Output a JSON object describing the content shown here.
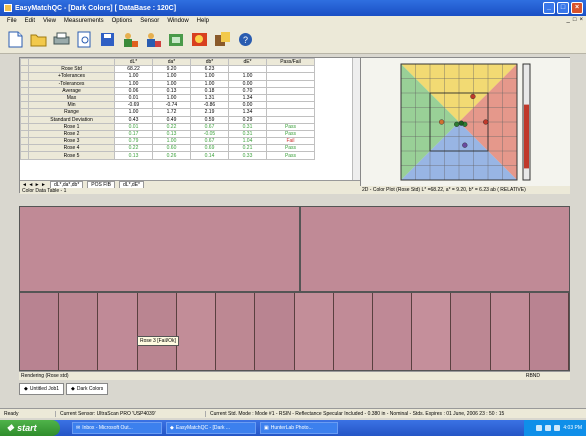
{
  "window": {
    "title": "EasyMatchQC - [Dark Colors]   [ DataBase : 120C]",
    "min": "_",
    "max": "□",
    "close": "×"
  },
  "menu": {
    "items": [
      "File",
      "Edit",
      "View",
      "Measurements",
      "Options",
      "Sensor",
      "Window",
      "Help"
    ],
    "mdi": [
      "_",
      "□",
      "×"
    ]
  },
  "toolbar": {
    "icons": [
      "new-icon",
      "open-icon",
      "print-icon",
      "preview-icon",
      "save-icon",
      "standardize-icon",
      "measure-icon",
      "read-icon",
      "database-icon",
      "export-icon",
      "help-icon"
    ]
  },
  "grid": {
    "headers": [
      "",
      "dL*",
      "da*",
      "db*",
      "dE*",
      "Pass/Fail"
    ],
    "stat_rows": [
      {
        "label": "Rose Std",
        "values": [
          "68.22",
          "9.20",
          "6.23",
          "",
          ""
        ]
      },
      {
        "label": "+Tolerances",
        "values": [
          "1.00",
          "1.00",
          "1.00",
          "1.00",
          ""
        ]
      },
      {
        "label": "-Tolerances",
        "values": [
          "1.00",
          "1.00",
          "1.00",
          "0.00",
          ""
        ]
      },
      {
        "label": "Average",
        "values": [
          "0.06",
          "0.13",
          "0.18",
          "0.70",
          ""
        ]
      },
      {
        "label": "Max",
        "values": [
          "0.01",
          "1.00",
          "1.31",
          "1.34",
          ""
        ]
      },
      {
        "label": "Min",
        "values": [
          "-0.69",
          "-0.74",
          "-0.86",
          "0.00",
          ""
        ]
      },
      {
        "label": "Range",
        "values": [
          "1.00",
          "1.72",
          "2.19",
          "1.34",
          ""
        ]
      },
      {
        "label": "Standard Deviation",
        "values": [
          "0.43",
          "0.49",
          "0.59",
          "0.29",
          ""
        ]
      }
    ],
    "sample_rows": [
      {
        "label": "Rose 1",
        "values": [
          "0.01",
          "0.22",
          "0.67",
          "0.31",
          "Pass"
        ],
        "fail": false
      },
      {
        "label": "Rose 2",
        "values": [
          "0.17",
          "0.13",
          "-0.05",
          "0.31",
          "Pass"
        ],
        "fail": false
      },
      {
        "label": "Rose 3",
        "values": [
          "0.79",
          "1.00",
          "0.67",
          "1.04",
          "Fail"
        ],
        "fail": true
      },
      {
        "label": "Rose 4",
        "values": [
          "0.22",
          "0.60",
          "0.69",
          "0.21",
          "Pass"
        ],
        "fail": false
      },
      {
        "label": "Rose 5",
        "values": [
          "0.13",
          "0.26",
          "0.14",
          "0.33",
          "Pass"
        ],
        "fail": false
      }
    ],
    "sheet_tabs": [
      "dL*,da*,db*",
      "POS FIB",
      "dL*,dE*"
    ],
    "caption": "Color Data Table - 1"
  },
  "plot": {
    "caption": "2D - Color Plot (Rose Std) L* =68.22, a* = 9.20, b* = 6.23   ab ( RELATIVE)",
    "quadrant_colors": [
      "#f2d24a",
      "#e07a6a",
      "#7aa0e0",
      "#7bc47a"
    ],
    "points": [
      {
        "x": 0.62,
        "y": 0.28,
        "color": "#c0392b"
      },
      {
        "x": 0.55,
        "y": 0.52,
        "color": "#2e7d32"
      },
      {
        "x": 0.48,
        "y": 0.52,
        "color": "#2e7d32"
      },
      {
        "x": 0.52,
        "y": 0.51,
        "color": "#1b5e20"
      },
      {
        "x": 0.35,
        "y": 0.5,
        "color": "#d07030"
      },
      {
        "x": 0.73,
        "y": 0.5,
        "color": "#c0392b"
      },
      {
        "x": 0.55,
        "y": 0.7,
        "color": "#6a4aa0"
      }
    ]
  },
  "swatches": {
    "standard_color": "#c08a96",
    "strip_colors": [
      "#b88391",
      "#bb8692",
      "#c08a97",
      "#ba8591",
      "#c28d98",
      "#bd8893",
      "#b98491",
      "#c38e99",
      "#c18b97",
      "#bf8996",
      "#c58f9b",
      "#bc8793",
      "#c28c98",
      "#b98391"
    ],
    "tooltip": "Rose 3 [Fail/Ok]"
  },
  "rendering": {
    "label": "Rendering (Rose std)",
    "right": "RBND"
  },
  "doc_tabs": [
    "Untitled Job1",
    "Dark Colors"
  ],
  "status": {
    "ready": "Ready",
    "sensor": "Current Sensor: UltraScan PRO 'USP4039'",
    "mode": "Current Std. Mode : Mode #1 - RSIN - Reflectance Specular Included - 0.380 in - Nominal - Stds. Expires : 01 June, 2006 23 : 50 : 15"
  },
  "taskbar": {
    "start": "start",
    "tasks": [
      "Inbox - Microsoft Out...",
      "EasyMatchQC - [Dark ...",
      "HunterLab Photo..."
    ],
    "time": "4:03 PM"
  }
}
